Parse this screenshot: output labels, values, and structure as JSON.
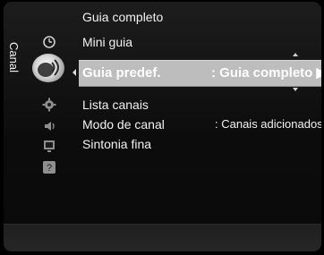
{
  "sidebar": {
    "label": "Canal"
  },
  "icons": {
    "items": [
      {
        "name": "clock-icon"
      },
      {
        "name": "satellite-dish-icon"
      },
      {
        "name": "settings-gear-icon"
      },
      {
        "name": "speaker-sound-icon"
      },
      {
        "name": "input-source-icon"
      },
      {
        "name": "help-icon"
      }
    ]
  },
  "menu": {
    "items": [
      {
        "label": "Guia completo",
        "value": ""
      },
      {
        "label": "Mini guia",
        "value": ""
      },
      {
        "label": "Guia predef.",
        "value": ": Guia completo ▶",
        "selected": true
      },
      {
        "label": "Lista canais",
        "value": ""
      },
      {
        "label": "Modo de canal",
        "value": ": Canais adicionados"
      },
      {
        "label": "Sintonia fina",
        "value": ""
      }
    ]
  },
  "colors": {
    "panel_bg": "#141414",
    "selection_bg": "#bdbdbd",
    "text": "#f2f2f2"
  }
}
